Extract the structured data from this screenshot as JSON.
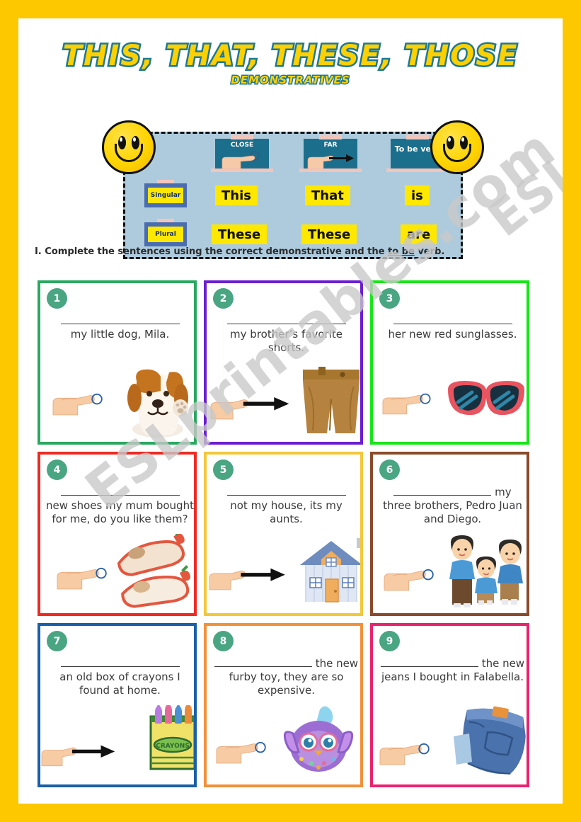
{
  "page": {
    "border_color": "#FDC800",
    "background": "#ffffff"
  },
  "header": {
    "title": "THIS, THAT, THESE, THOSE",
    "subtitle": "DEMONSTRATIVES",
    "title_fill": "#FFD000",
    "title_stroke": "#1b7a96"
  },
  "watermark": {
    "main": "ESLprintables.com",
    "corner": "ESLprintables.com"
  },
  "grammar_panel": {
    "background": "#aecbdd",
    "border_style": "dashed-black",
    "column_headers": [
      {
        "label": "CLOSE",
        "icon": "pointing-hand-close-icon"
      },
      {
        "label": "FAR",
        "icon": "pointing-hand-far-arrow-icon"
      },
      {
        "label": "To be verb",
        "icon": "none"
      }
    ],
    "row_labels": [
      {
        "label": "Singular"
      },
      {
        "label": "Plural"
      }
    ],
    "cells": {
      "singular": {
        "close": "This",
        "far": "That",
        "tobe": "is"
      },
      "plural": {
        "close": "These",
        "far": "These",
        "tobe": "are"
      }
    },
    "decor": {
      "smiley_left": "smiley-face-icon",
      "smiley_right": "smiley-face-icon"
    }
  },
  "instruction": {
    "prefix": "I. Complete the sentences using the correct demonstrative and the ",
    "underlined": "to be",
    "suffix": " verb."
  },
  "exercises": [
    {
      "number": "1",
      "border_color": "#2aa860",
      "blank_position": "start",
      "blank_width": 168,
      "text_before": "",
      "text_after": "my little dog, Mila.",
      "illustration": "hand-pointing-at-dog",
      "distance": "close"
    },
    {
      "number": "2",
      "border_color": "#6a1fd0",
      "blank_position": "start",
      "blank_width": 168,
      "text_before": "",
      "text_after": "my brother’s favorite shorts.",
      "illustration": "hand-arrow-pointing-at-shorts",
      "distance": "far"
    },
    {
      "number": "3",
      "border_color": "#19E619",
      "blank_position": "start",
      "blank_width": 168,
      "text_before": "",
      "text_after": "her new red sunglasses.",
      "illustration": "hand-pointing-at-sunglasses",
      "distance": "close"
    },
    {
      "number": "4",
      "border_color": "#ED2B23",
      "blank_position": "start",
      "blank_width": 168,
      "text_before": "",
      "text_after": "new shoes my mum bought for me, do you like them?",
      "illustration": "hand-pointing-at-red-shoes",
      "distance": "close"
    },
    {
      "number": "5",
      "border_color": "#F2C83C",
      "blank_position": "start",
      "blank_width": 168,
      "text_before": "",
      "text_after": "not my house, its my aunts.",
      "illustration": "hand-arrow-pointing-at-house",
      "distance": "far"
    },
    {
      "number": "6",
      "border_color": "#8A4A2B",
      "blank_position": "inline",
      "blank_width": 138,
      "text_before": "",
      "text_after": " my three brothers, Pedro Juan and Diego.",
      "illustration": "hand-pointing-at-three-brothers",
      "distance": "close"
    },
    {
      "number": "7",
      "border_color": "#1A5FA8",
      "blank_position": "start",
      "blank_width": 168,
      "text_before": "",
      "text_after": "an old box of crayons I found at home.",
      "illustration": "hand-arrow-pointing-at-crayons",
      "distance": "far"
    },
    {
      "number": "8",
      "border_color": "#F2913C",
      "blank_position": "inline",
      "blank_width": 138,
      "text_before": "",
      "text_after": " the new furby toy, they are so expensive.",
      "illustration": "hand-pointing-at-furby",
      "distance": "close"
    },
    {
      "number": "9",
      "border_color": "#E8246E",
      "blank_position": "inline",
      "blank_width": 138,
      "text_before": "",
      "text_after": " the new jeans I bought in Falabella.",
      "illustration": "hand-pointing-at-jeans",
      "distance": "close"
    }
  ]
}
